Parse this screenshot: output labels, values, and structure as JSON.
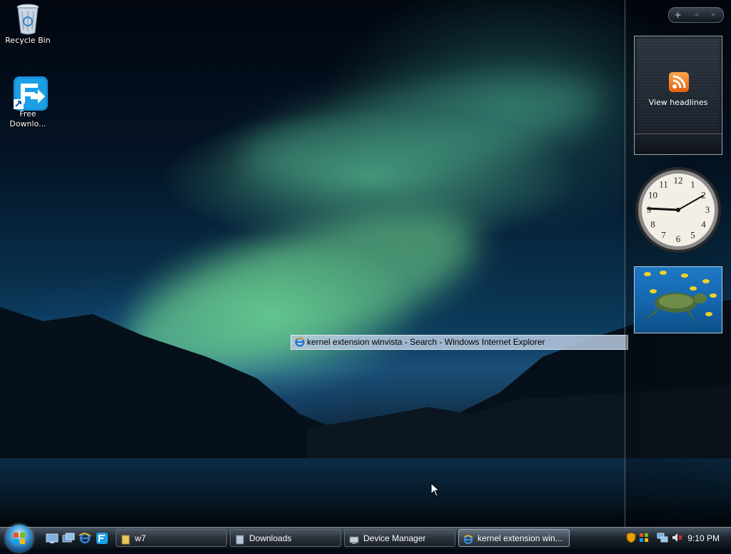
{
  "desktop": {
    "icons": [
      {
        "label": "Recycle Bin"
      },
      {
        "label": "Free Downlo..."
      }
    ]
  },
  "sidebar": {
    "controls": {
      "add": "+",
      "prev": "◄",
      "next": "►"
    },
    "feed_gadget": {
      "label": "View headlines"
    },
    "clock_gadget": {
      "time": "9:10",
      "numbers": [
        "12",
        "1",
        "2",
        "3",
        "4",
        "5",
        "6",
        "7",
        "8",
        "9",
        "10",
        "11"
      ]
    },
    "slideshow_gadget": {
      "subject": "sea turtle with fish"
    }
  },
  "tooltip": {
    "text": "kernel extension winvista - Search - Windows Internet Explorer"
  },
  "taskbar": {
    "buttons": [
      {
        "label": "w7",
        "icon": "folder-icon",
        "active": false
      },
      {
        "label": "Downloads",
        "icon": "folder-icon",
        "active": false
      },
      {
        "label": "Device Manager",
        "icon": "device-manager-icon",
        "active": false
      },
      {
        "label": "kernel extension win...",
        "icon": "ie-icon",
        "active": true
      }
    ],
    "quick_launch": [
      "show-desktop-icon",
      "switch-windows-icon",
      "ie-icon",
      "free-download-manager-icon"
    ],
    "tray": {
      "clock": "9:10 PM"
    }
  },
  "colors": {
    "rss": "#f7901e",
    "taskbar": "#1d2630",
    "tooltip": "#b9cae1"
  }
}
